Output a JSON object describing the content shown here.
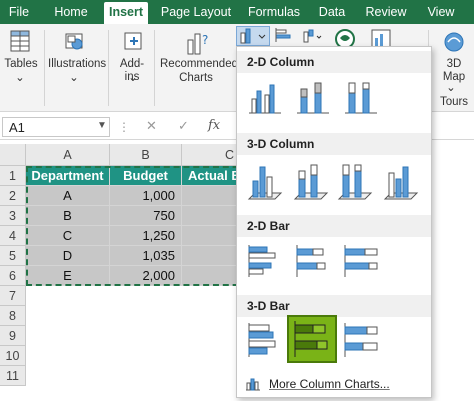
{
  "menu_tabs": [
    "File",
    "Home",
    "Insert",
    "Page Layout",
    "Formulas",
    "Data",
    "Review",
    "View"
  ],
  "ribbon": {
    "tables_label": "Tables",
    "illustrations_label": "Illustrations",
    "addins_label": "Add-ins",
    "recommended_label_1": "Recommended",
    "recommended_label_2": "Charts",
    "map3d_label_1": "3D",
    "map3d_label_2": "Map",
    "tours_label": "Tours"
  },
  "formula_bar": {
    "name_box": "A1",
    "fx_label": "fx",
    "value": ""
  },
  "sheet": {
    "columns": [
      "A",
      "B",
      "C"
    ],
    "rows": [
      "1",
      "2",
      "3",
      "4",
      "5",
      "6",
      "7",
      "8",
      "9",
      "10",
      "11"
    ],
    "header": [
      "Department",
      "Budget",
      "Actual B"
    ],
    "data": [
      [
        "A",
        "1,000",
        ""
      ],
      [
        "B",
        "750",
        ""
      ],
      [
        "C",
        "1,250",
        ""
      ],
      [
        "D",
        "1,035",
        ""
      ],
      [
        "E",
        "2,000",
        ""
      ]
    ]
  },
  "dropdown": {
    "sections": [
      "2-D Column",
      "3-D Column",
      "2-D Bar",
      "3-D Bar"
    ],
    "more_link": "More Column Charts..."
  },
  "colors": {
    "excel_green": "#217346",
    "header_teal": "#1f9384",
    "data_gray": "#c7c7c7",
    "selected_green": "#7ab317",
    "bar_blue": "#5b9bd5"
  }
}
